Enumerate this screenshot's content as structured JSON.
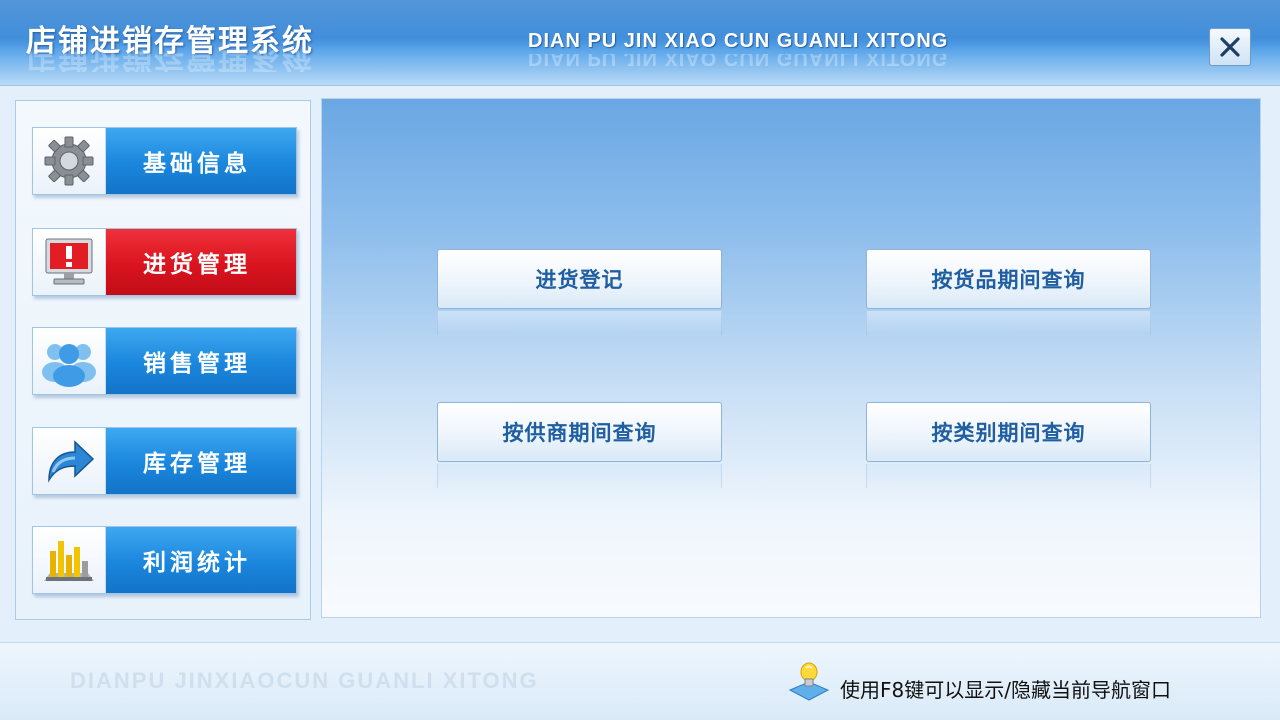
{
  "window": {
    "title": "店铺进销存管理系统",
    "subtitle": "DIAN PU JIN XIAO CUN GUANLI XITONG",
    "close_icon": "close-icon"
  },
  "nav": {
    "items": [
      {
        "label": "基础信息",
        "icon": "gear-icon",
        "active": false
      },
      {
        "label": "进货管理",
        "icon": "alert-monitor-icon",
        "active": true
      },
      {
        "label": "销售管理",
        "icon": "users-icon",
        "active": false
      },
      {
        "label": "库存管理",
        "icon": "arrow-icon",
        "active": false
      },
      {
        "label": "利润统计",
        "icon": "bar-chart-icon",
        "active": false
      }
    ]
  },
  "actions": {
    "items": [
      {
        "label": "进货登记"
      },
      {
        "label": "按货品期间查询"
      },
      {
        "label": "按供商期间查询"
      },
      {
        "label": "按类别期间查询"
      }
    ]
  },
  "footer": {
    "brand": "DIANPU JINXIAOCUN GUANLI XITONG",
    "hint": "使用F8键可以显示/隐藏当前导航窗口",
    "hint_icon": "lightbulb-icon"
  },
  "colors": {
    "accent_blue": "#1a86dc",
    "active_red": "#d9141f",
    "button_text": "#1f5ea0"
  }
}
